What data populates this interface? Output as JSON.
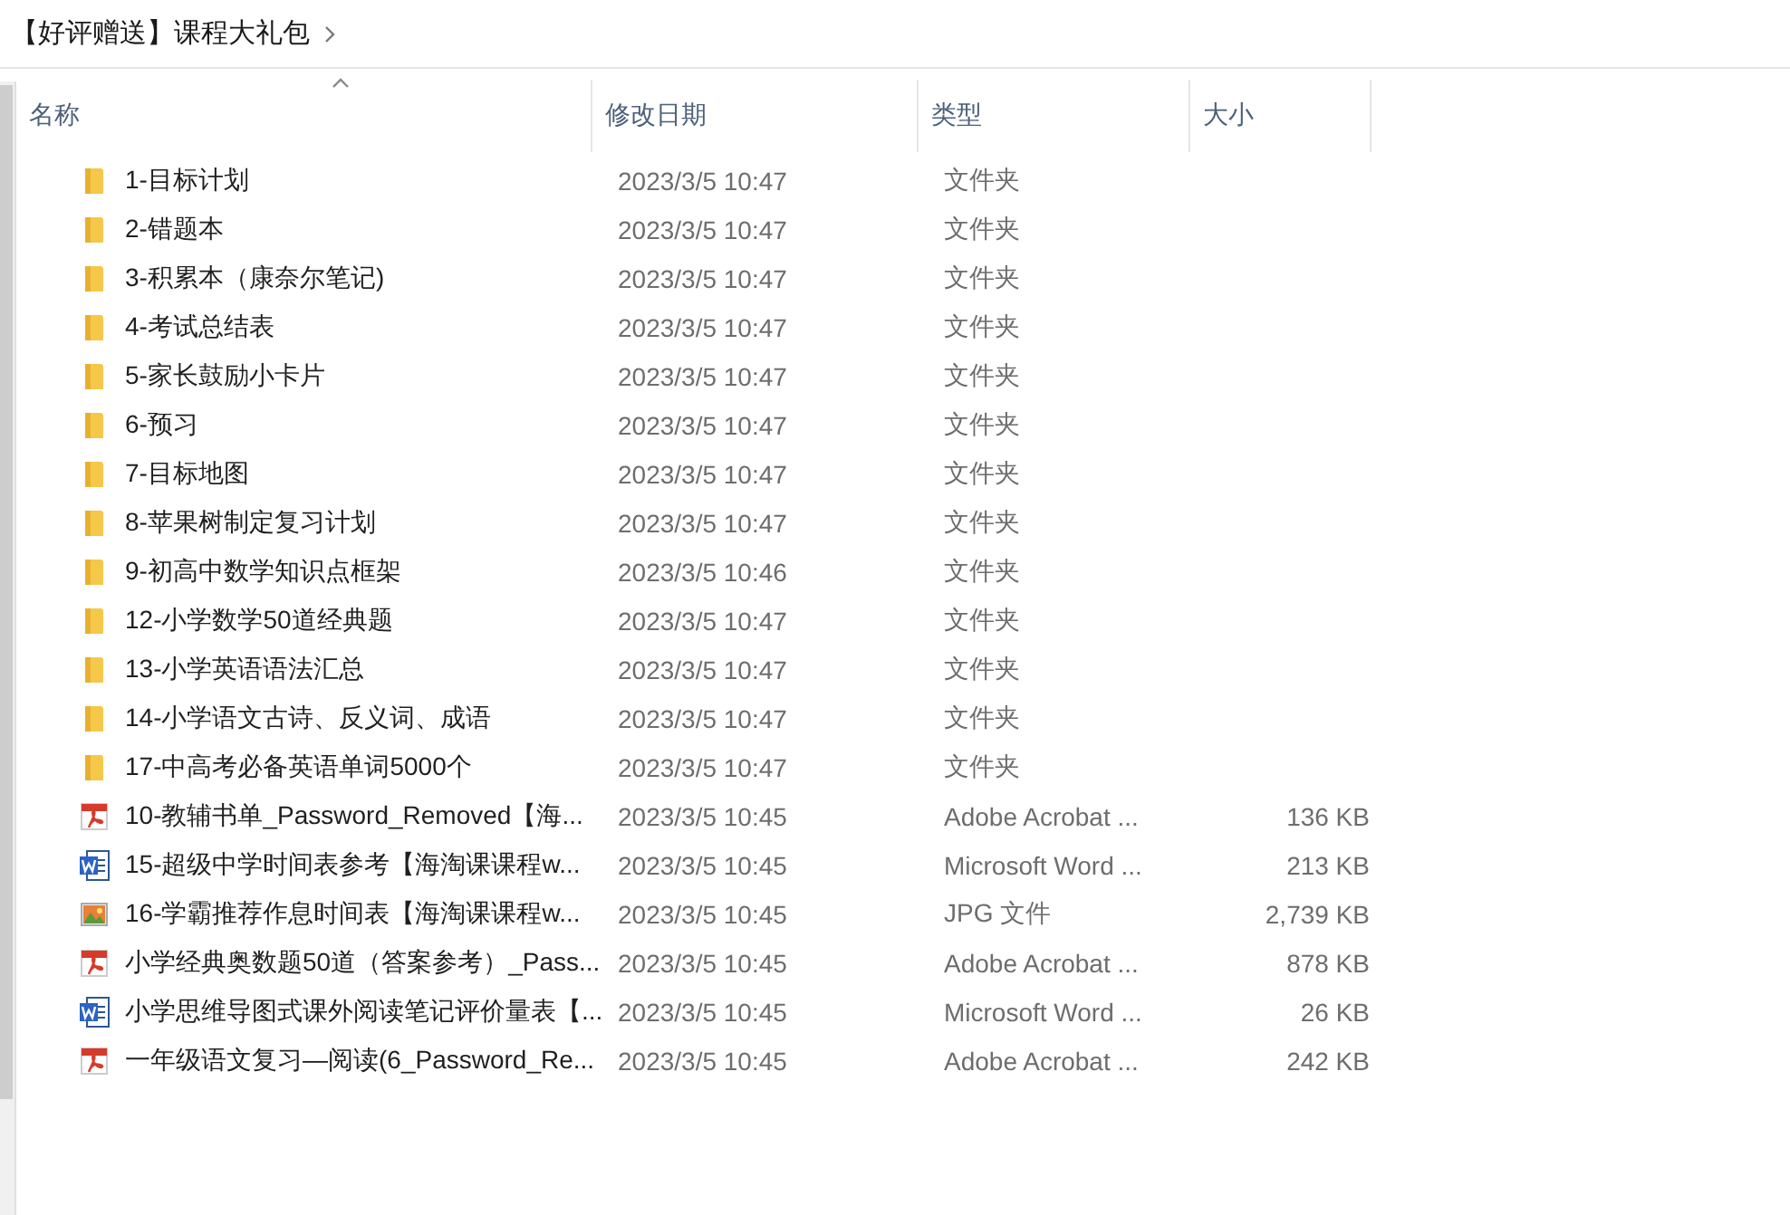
{
  "breadcrumb": {
    "folder": "【好评赠送】课程大礼包"
  },
  "columns": [
    "名称",
    "修改日期",
    "类型",
    "大小"
  ],
  "files": [
    {
      "kind": "folder",
      "name": "1-目标计划",
      "date": "2023/3/5 10:47",
      "type": "文件夹"
    },
    {
      "kind": "folder",
      "name": "2-错题本",
      "date": "2023/3/5 10:47",
      "type": "文件夹"
    },
    {
      "kind": "folder",
      "name": "3-积累本（康奈尔笔记)",
      "date": "2023/3/5 10:47",
      "type": "文件夹"
    },
    {
      "kind": "folder",
      "name": "4-考试总结表",
      "date": "2023/3/5 10:47",
      "type": "文件夹"
    },
    {
      "kind": "folder",
      "name": "5-家长鼓励小卡片",
      "date": "2023/3/5 10:47",
      "type": "文件夹"
    },
    {
      "kind": "folder",
      "name": "6-预习",
      "date": "2023/3/5 10:47",
      "type": "文件夹"
    },
    {
      "kind": "folder",
      "name": "7-目标地图",
      "date": "2023/3/5 10:47",
      "type": "文件夹"
    },
    {
      "kind": "folder",
      "name": "8-苹果树制定复习计划",
      "date": "2023/3/5 10:47",
      "type": "文件夹"
    },
    {
      "kind": "folder",
      "name": "9-初高中数学知识点框架",
      "date": "2023/3/5 10:46",
      "type": "文件夹"
    },
    {
      "kind": "folder",
      "name": "12-小学数学50道经典题",
      "date": "2023/3/5 10:47",
      "type": "文件夹"
    },
    {
      "kind": "folder",
      "name": "13-小学英语语法汇总",
      "date": "2023/3/5 10:47",
      "type": "文件夹"
    },
    {
      "kind": "folder",
      "name": "14-小学语文古诗、反义词、成语",
      "date": "2023/3/5 10:47",
      "type": "文件夹"
    },
    {
      "kind": "folder",
      "name": "17-中高考必备英语单词5000个",
      "date": "2023/3/5 10:47",
      "type": "文件夹"
    },
    {
      "kind": "pdf",
      "name": "10-教辅书单_Password_Removed【海...",
      "date": "2023/3/5 10:45",
      "type": "Adobe Acrobat ...",
      "size": "136 KB"
    },
    {
      "kind": "word",
      "name": "15-超级中学时间表参考【海淘课课程w...",
      "date": "2023/3/5 10:45",
      "type": "Microsoft Word ...",
      "size": "213 KB"
    },
    {
      "kind": "jpg",
      "name": "16-学霸推荐作息时间表【海淘课课程w...",
      "date": "2023/3/5 10:45",
      "type": "JPG 文件",
      "size": "2,739 KB"
    },
    {
      "kind": "pdf",
      "name": "小学经典奥数题50道（答案参考）_Pass...",
      "date": "2023/3/5 10:45",
      "type": "Adobe Acrobat ...",
      "size": "878 KB"
    },
    {
      "kind": "word",
      "name": "小学思维导图式课外阅读笔记评价量表【...",
      "date": "2023/3/5 10:45",
      "type": "Microsoft Word ...",
      "size": "26 KB"
    },
    {
      "kind": "pdf",
      "name": "一年级语文复习—阅读(6_Password_Re...",
      "date": "2023/3/5 10:45",
      "type": "Adobe Acrobat ...",
      "size": "242 KB"
    }
  ]
}
